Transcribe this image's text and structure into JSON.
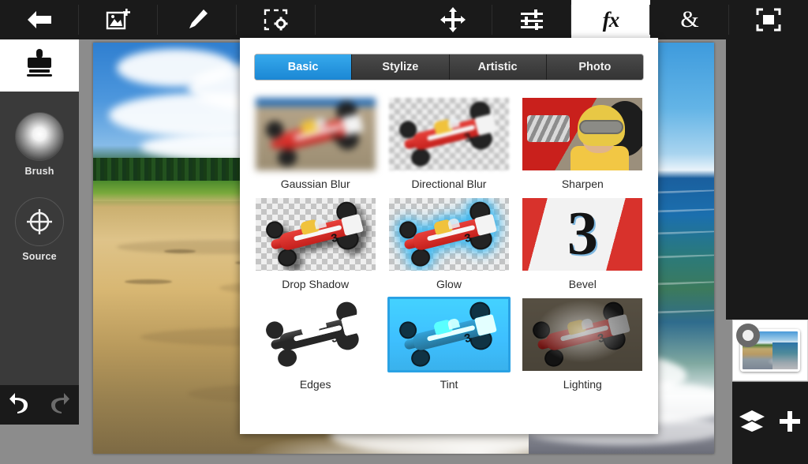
{
  "toolbar": {
    "items": [
      {
        "name": "back",
        "icon": "back-arrow-icon",
        "label": ""
      },
      {
        "name": "add-image",
        "icon": "add-image-icon",
        "label": ""
      },
      {
        "name": "draw",
        "icon": "pencil-icon",
        "label": ""
      },
      {
        "name": "selection-settings",
        "icon": "selection-gear-icon",
        "label": ""
      },
      {
        "name": "transform",
        "icon": "move-arrows-icon",
        "label": ""
      },
      {
        "name": "adjustments",
        "icon": "sliders-icon",
        "label": ""
      },
      {
        "name": "effects",
        "icon": "fx-icon",
        "label": "fx",
        "active": true
      },
      {
        "name": "blend",
        "icon": "ampersand-icon",
        "label": "&"
      },
      {
        "name": "fullscreen",
        "icon": "fullscreen-icon",
        "label": ""
      }
    ]
  },
  "sidebar": {
    "active_tool": "clone-stamp",
    "items": [
      {
        "label": "Brush",
        "icon": "soft-brush-icon"
      },
      {
        "label": "Source",
        "icon": "crosshair-target-icon"
      }
    ],
    "history": [
      {
        "label": "Undo",
        "icon": "undo-arrow-icon",
        "enabled": true
      },
      {
        "label": "Redo",
        "icon": "redo-arrow-icon",
        "enabled": false
      }
    ]
  },
  "layers_panel": {
    "thumbnail_alt": "beach-layer-thumbnail",
    "buttons": [
      {
        "label": "Layers",
        "icon": "layers-stack-icon"
      },
      {
        "label": "Add",
        "icon": "plus-icon"
      }
    ]
  },
  "effects_panel": {
    "tabs": [
      {
        "label": "Basic",
        "active": true
      },
      {
        "label": "Stylize",
        "active": false
      },
      {
        "label": "Artistic",
        "active": false
      },
      {
        "label": "Photo",
        "active": false
      }
    ],
    "effects": [
      {
        "label": "Gaussian Blur",
        "style": "gaussian",
        "selected": false
      },
      {
        "label": "Directional Blur",
        "style": "directional",
        "selected": false
      },
      {
        "label": "Sharpen",
        "style": "sharpen",
        "selected": false
      },
      {
        "label": "Drop Shadow",
        "style": "dropshadow",
        "selected": false
      },
      {
        "label": "Glow",
        "style": "glow",
        "selected": false
      },
      {
        "label": "Bevel",
        "style": "bevel",
        "selected": false
      },
      {
        "label": "Edges",
        "style": "edges",
        "selected": false
      },
      {
        "label": "Tint",
        "style": "tint",
        "selected": true
      },
      {
        "label": "Lighting",
        "style": "lighting",
        "selected": false
      }
    ]
  },
  "colors": {
    "accent": "#2aa2e4",
    "toolbar_bg": "#1a1a1a",
    "panel_bg": "#ffffff",
    "sidebar_bg": "#3a3a3a",
    "canvas_bg": "#8c8c8c"
  },
  "canvas": {
    "image_alt": "beach-shoreline-photo"
  }
}
